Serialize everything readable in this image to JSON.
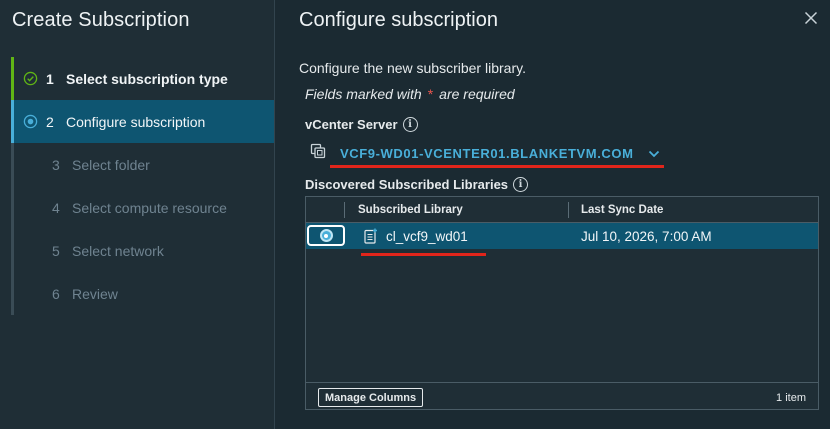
{
  "wizard": {
    "title": "Create Subscription",
    "steps": [
      {
        "num": "1",
        "label": "Select subscription type",
        "state": "done"
      },
      {
        "num": "2",
        "label": "Configure subscription",
        "state": "active"
      },
      {
        "num": "3",
        "label": "Select folder",
        "state": "disabled"
      },
      {
        "num": "4",
        "label": "Select compute resource",
        "state": "disabled"
      },
      {
        "num": "5",
        "label": "Select network",
        "state": "disabled"
      },
      {
        "num": "6",
        "label": "Review",
        "state": "disabled"
      }
    ]
  },
  "content": {
    "title": "Configure subscription",
    "description": "Configure the new subscriber library.",
    "required_prefix": "Fields marked with",
    "required_star": "*",
    "required_suffix": "are required",
    "vcenter_label": "vCenter Server",
    "vcenter_value": "VCF9-WD01-VCENTER01.BLANKETVM.COM",
    "libraries_label": "Discovered Subscribed Libraries",
    "grid": {
      "columns": [
        "Subscribed Library",
        "Last Sync Date"
      ],
      "rows": [
        {
          "library": "cl_vcf9_wd01",
          "last_sync": "Jul 10, 2026, 7:00 AM",
          "selected": true
        }
      ],
      "manage_columns_label": "Manage Columns",
      "item_count": "1 item"
    }
  },
  "colors": {
    "accent": "#49afd9",
    "selected_row": "#0e5571",
    "done_step": "#60b515",
    "annotation_red": "#e1251b"
  }
}
